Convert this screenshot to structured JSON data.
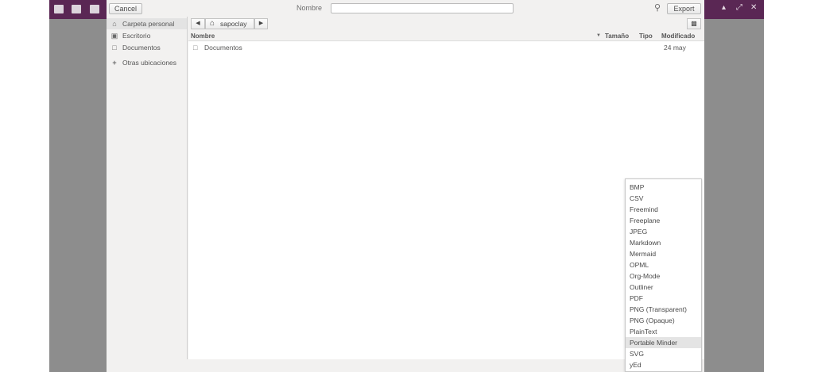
{
  "app": {
    "window_controls": [
      "▴",
      "⤢",
      "✕"
    ],
    "toolbar_icons": [
      "document-icon",
      "folder-icon",
      "save-icon"
    ]
  },
  "dialog": {
    "cancel_label": "Cancel",
    "name_label": "Nombre",
    "name_value": "",
    "export_label": "Export"
  },
  "sidebar": {
    "items": [
      {
        "label": "Carpeta personal",
        "icon": "home-icon",
        "selected": true
      },
      {
        "label": "Escritorio",
        "icon": "desktop-icon",
        "selected": false
      },
      {
        "label": "Documentos",
        "icon": "document-icon",
        "selected": false
      },
      {
        "label": "Otras ubicaciones",
        "icon": "plus-icon",
        "selected": false
      }
    ]
  },
  "path": {
    "current": "sapoclay"
  },
  "columns": {
    "name": "Nombre",
    "size": "Tamaño",
    "type": "Tipo",
    "modified": "Modificado"
  },
  "files": [
    {
      "name": "Documentos",
      "size": "",
      "type": "",
      "modified": "24 may"
    }
  ],
  "formats": {
    "items": [
      "BMP",
      "CSV",
      "Freemind",
      "Freeplane",
      "JPEG",
      "Markdown",
      "Mermaid",
      "OPML",
      "Org-Mode",
      "Outliner",
      "PDF",
      "PNG (Transparent)",
      "PNG (Opaque)",
      "PlainText",
      "Portable Minder",
      "SVG",
      "yEd"
    ],
    "highlighted": "Portable Minder"
  },
  "colors": {
    "titlebar": "#5a2754",
    "dialog_bg": "#f2f1f0"
  }
}
